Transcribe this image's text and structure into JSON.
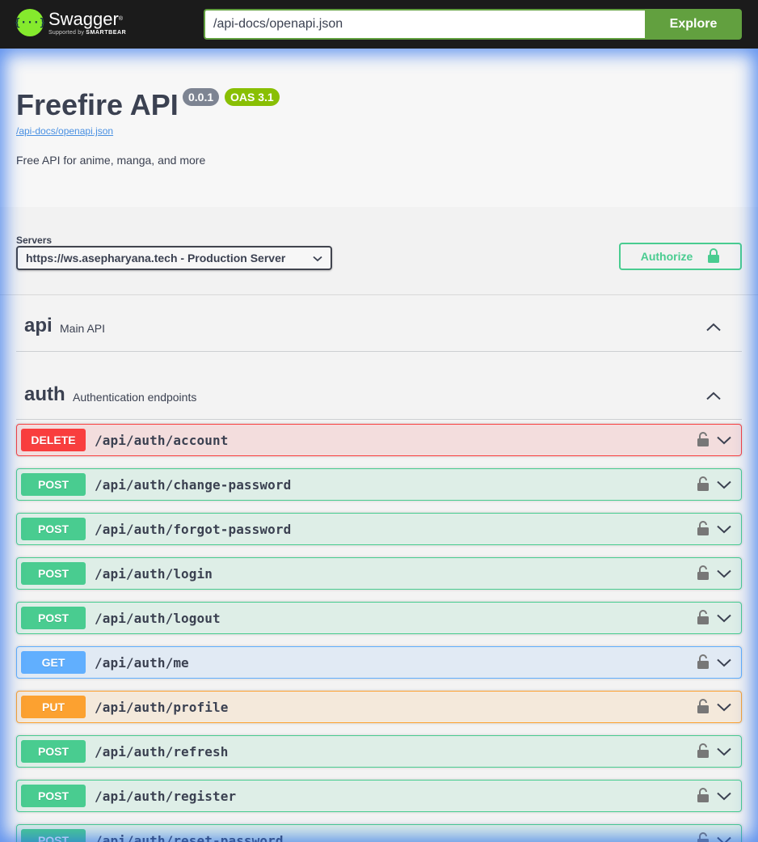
{
  "topbar": {
    "logo_title": "Swagger",
    "logo_mark": "{···}",
    "logo_sub_prefix": "Supported by",
    "logo_sub_brand": "SMARTBEAR",
    "url_value": "/api-docs/openapi.json",
    "explore_label": "Explore"
  },
  "info": {
    "title": "Freefire API",
    "version": "0.0.1",
    "oas": "OAS 3.1",
    "spec_link": "/api-docs/openapi.json",
    "description": "Free API for anime, manga, and more"
  },
  "scheme": {
    "servers_label": "Servers",
    "selected_server": "https://ws.asepharyana.tech - Production Server",
    "authorize_label": "Authorize"
  },
  "tags": [
    {
      "name": "api",
      "description": "Main API"
    },
    {
      "name": "auth",
      "description": "Authentication endpoints"
    }
  ],
  "operations": [
    {
      "method": "DELETE",
      "path": "/api/auth/account"
    },
    {
      "method": "POST",
      "path": "/api/auth/change-password"
    },
    {
      "method": "POST",
      "path": "/api/auth/forgot-password"
    },
    {
      "method": "POST",
      "path": "/api/auth/login"
    },
    {
      "method": "POST",
      "path": "/api/auth/logout"
    },
    {
      "method": "GET",
      "path": "/api/auth/me"
    },
    {
      "method": "PUT",
      "path": "/api/auth/profile"
    },
    {
      "method": "POST",
      "path": "/api/auth/refresh"
    },
    {
      "method": "POST",
      "path": "/api/auth/register"
    },
    {
      "method": "POST",
      "path": "/api/auth/reset-password"
    }
  ],
  "colors": {
    "delete": "#f93e3e",
    "post": "#49cc90",
    "get": "#61affe",
    "put": "#fca130",
    "explore": "#62a03f",
    "logo": "#85ea2d"
  },
  "icons": {
    "logo": "swagger-logo-icon",
    "select": "chevron-down-icon",
    "authorize": "lock-icon",
    "tag_toggle": "chevron-up-icon",
    "op_lock": "unlocked-padlock-icon",
    "op_toggle": "chevron-down-icon"
  }
}
